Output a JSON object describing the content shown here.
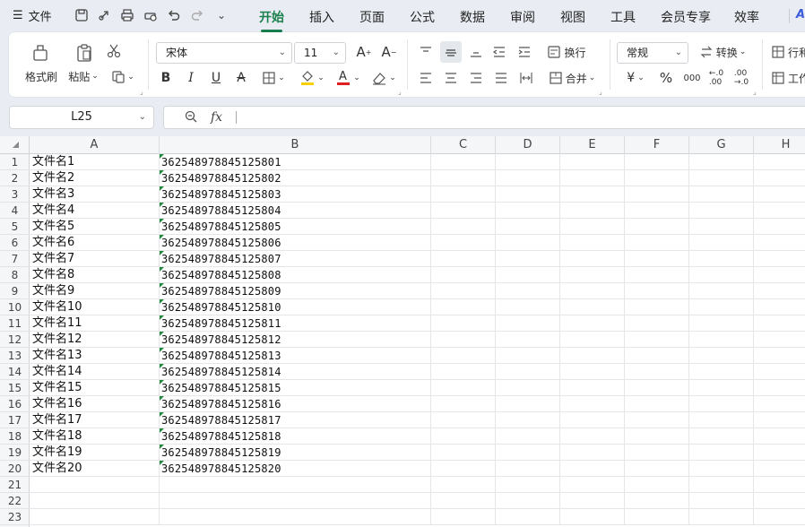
{
  "menu": {
    "file_label": "文件",
    "tabs": [
      "开始",
      "插入",
      "页面",
      "公式",
      "数据",
      "审阅",
      "视图",
      "工具",
      "会员专享",
      "效率"
    ]
  },
  "ribbon": {
    "format_painter": "格式刷",
    "paste": "粘贴",
    "font_name": "宋体",
    "font_size": "11",
    "wrap": "换行",
    "merge": "合并",
    "number_format": "常规",
    "convert": "转换",
    "row_col": "行和",
    "worksheet": "工作"
  },
  "formula_bar": {
    "name_box": "L25",
    "fx": "fx",
    "formula": ""
  },
  "sheet": {
    "columns": [
      "A",
      "B",
      "C",
      "D",
      "E",
      "F",
      "G",
      "H"
    ],
    "row_numbers": [
      "1",
      "2",
      "3",
      "4",
      "5",
      "6",
      "7",
      "8",
      "9",
      "10",
      "11",
      "12",
      "13",
      "14",
      "15",
      "16",
      "17",
      "18",
      "19",
      "20",
      "21",
      "22",
      "23"
    ],
    "rows": [
      {
        "a": "文件名1",
        "b": "362548978845125801"
      },
      {
        "a": "文件名2",
        "b": "362548978845125802"
      },
      {
        "a": "文件名3",
        "b": "362548978845125803"
      },
      {
        "a": "文件名4",
        "b": "362548978845125804"
      },
      {
        "a": "文件名5",
        "b": "362548978845125805"
      },
      {
        "a": "文件名6",
        "b": "362548978845125806"
      },
      {
        "a": "文件名7",
        "b": "362548978845125807"
      },
      {
        "a": "文件名8",
        "b": "362548978845125808"
      },
      {
        "a": "文件名9",
        "b": "362548978845125809"
      },
      {
        "a": "文件名10",
        "b": "362548978845125810"
      },
      {
        "a": "文件名11",
        "b": "362548978845125811"
      },
      {
        "a": "文件名12",
        "b": "362548978845125812"
      },
      {
        "a": "文件名13",
        "b": "362548978845125813"
      },
      {
        "a": "文件名14",
        "b": "362548978845125814"
      },
      {
        "a": "文件名15",
        "b": "362548978845125815"
      },
      {
        "a": "文件名16",
        "b": "362548978845125816"
      },
      {
        "a": "文件名17",
        "b": "362548978845125817"
      },
      {
        "a": "文件名18",
        "b": "362548978845125818"
      },
      {
        "a": "文件名19",
        "b": "362548978845125819"
      },
      {
        "a": "文件名20",
        "b": "362548978845125820"
      },
      {
        "a": "",
        "b": ""
      },
      {
        "a": "",
        "b": ""
      },
      {
        "a": "",
        "b": ""
      }
    ]
  },
  "colors": {
    "accent": "#1a7f4e",
    "text_triangle": "#1f8a3e",
    "fill_highlight": "#f5d100",
    "font_color_bar": "#e02020"
  }
}
